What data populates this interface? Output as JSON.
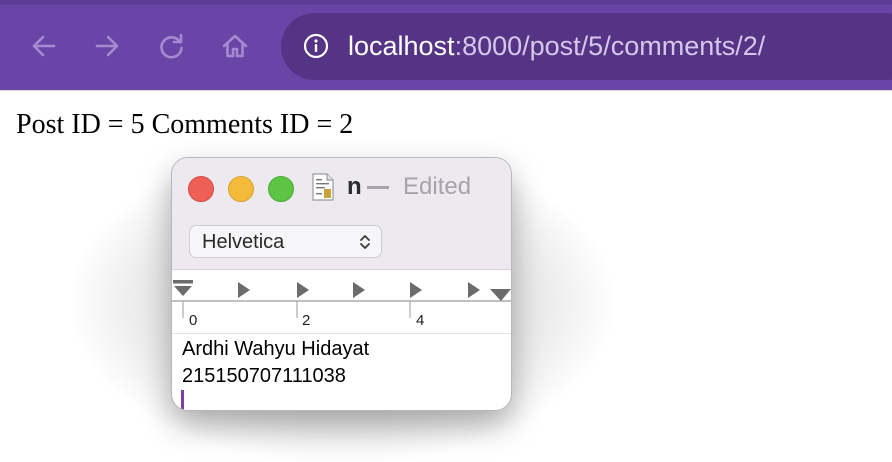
{
  "browser": {
    "url_host": "localhost",
    "url_path": ":8000/post/5/comments/2/",
    "icons": [
      "arrow-left-icon",
      "arrow-right-icon",
      "reload-icon",
      "home-icon",
      "info-icon"
    ]
  },
  "page": {
    "text": "Post ID = 5 Comments ID = 2"
  },
  "textedit": {
    "title_name": "n",
    "title_status": "Edited",
    "font_name": "Helvetica",
    "ruler_labels": [
      "0",
      "2",
      "4"
    ],
    "lines": [
      "Ardhi Wahyu Hidayat",
      "215150707111038"
    ]
  },
  "colors": {
    "toolbar": "#6a45a8",
    "urlbar": "#553486",
    "close": "#ee5f56",
    "minimize": "#f4bb3b",
    "maximize": "#5ec443",
    "caret": "#7b3fa6"
  }
}
